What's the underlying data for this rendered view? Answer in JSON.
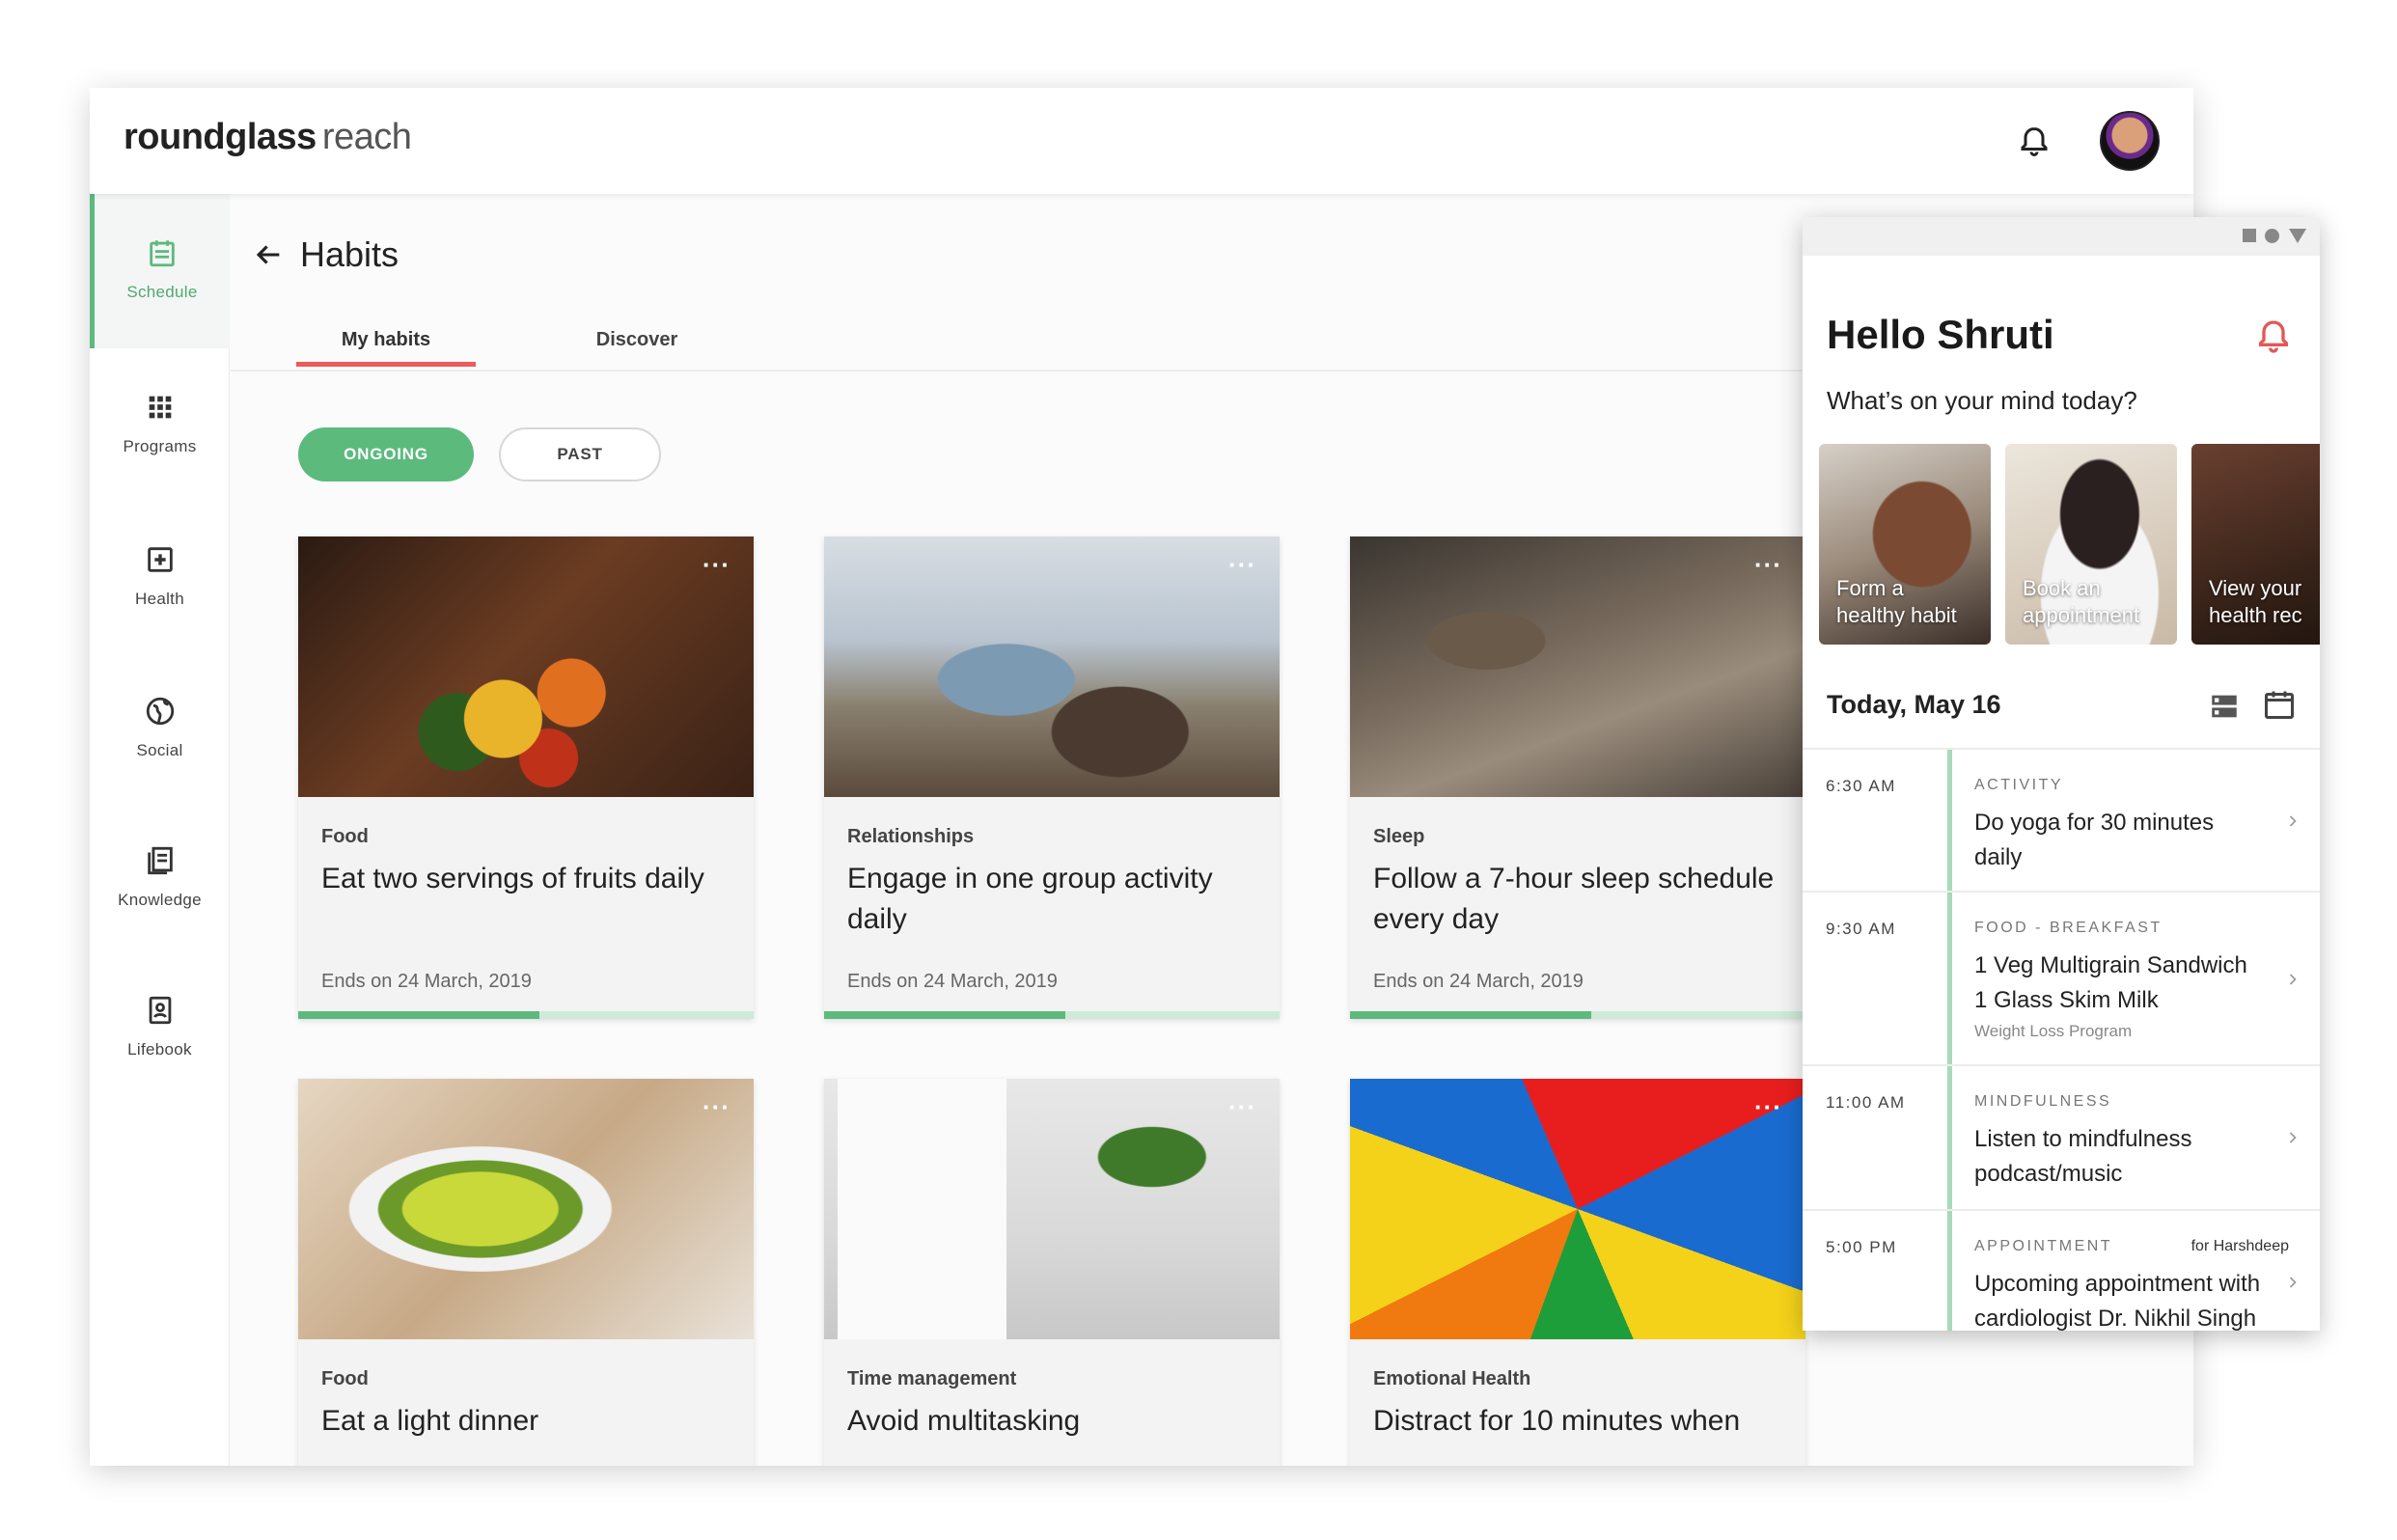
{
  "app": {
    "logo_brand": "roundglass",
    "logo_product": "reach"
  },
  "sidebar": {
    "items": [
      {
        "label": "Schedule",
        "icon": "calendar-icon",
        "active": true
      },
      {
        "label": "Programs",
        "icon": "grid-icon",
        "active": false
      },
      {
        "label": "Health",
        "icon": "plus-box-icon",
        "active": false
      },
      {
        "label": "Social",
        "icon": "globe-icon",
        "active": false
      },
      {
        "label": "Knowledge",
        "icon": "book-icon",
        "active": false
      },
      {
        "label": "Lifebook",
        "icon": "contact-book-icon",
        "active": false
      }
    ]
  },
  "page": {
    "title": "Habits",
    "tabs": [
      {
        "label": "My habits",
        "active": true
      },
      {
        "label": "Discover",
        "active": false
      }
    ],
    "filters": {
      "ongoing": "ONGOING",
      "past": "PAST"
    }
  },
  "cards": [
    {
      "category": "Food",
      "title": "Eat two servings of fruits daily",
      "ends": "Ends on 24 March, 2019",
      "progress": 0.53
    },
    {
      "category": "Relationships",
      "title": "Engage in one group activity daily",
      "ends": "Ends on 24 March, 2019",
      "progress": 0.53
    },
    {
      "category": "Sleep",
      "title": "Follow a 7-hour sleep schedule every day",
      "ends": "Ends on 24 March, 2019",
      "progress": 0.53
    },
    {
      "category": "Food",
      "title": "Eat a light dinner",
      "ends": "",
      "progress": 0
    },
    {
      "category": "Time management",
      "title": "Avoid multitasking",
      "ends": "",
      "progress": 0
    },
    {
      "category": "Emotional Health",
      "title": "Distract for 10 minutes when",
      "ends": "",
      "progress": 0
    }
  ],
  "mobile": {
    "greeting": "Hello Shruti",
    "prompt": "What’s on your mind today?",
    "quick_actions": [
      {
        "line1": "Form a",
        "line2": "healthy habit"
      },
      {
        "line1": "Book an",
        "line2": "appointment"
      },
      {
        "line1": "View your",
        "line2": "health rec"
      }
    ],
    "today": "Today, May 16",
    "schedule": [
      {
        "time": "6:30 AM",
        "kind": "ACTIVITY",
        "desc": "Do yoga for 30 minutes daily",
        "sub": "",
        "for": ""
      },
      {
        "time": "9:30 AM",
        "kind": "FOOD - BREAKFAST",
        "desc": "1 Veg Multigrain Sandwich 1 Glass Skim Milk",
        "sub": "Weight Loss Program",
        "for": ""
      },
      {
        "time": "11:00 AM",
        "kind": "MINDFULNESS",
        "desc": "Listen to mindfulness podcast/music",
        "sub": "",
        "for": ""
      },
      {
        "time": "5:00 PM",
        "kind": "APPOINTMENT",
        "desc": "Upcoming appointment with cardiologist Dr. Nikhil Singh",
        "sub": "",
        "for": "for Harshdeep"
      }
    ]
  },
  "colors": {
    "accent_green": "#5cba7d",
    "tab_red": "#ec5a5a",
    "bell_red": "#e45757"
  }
}
